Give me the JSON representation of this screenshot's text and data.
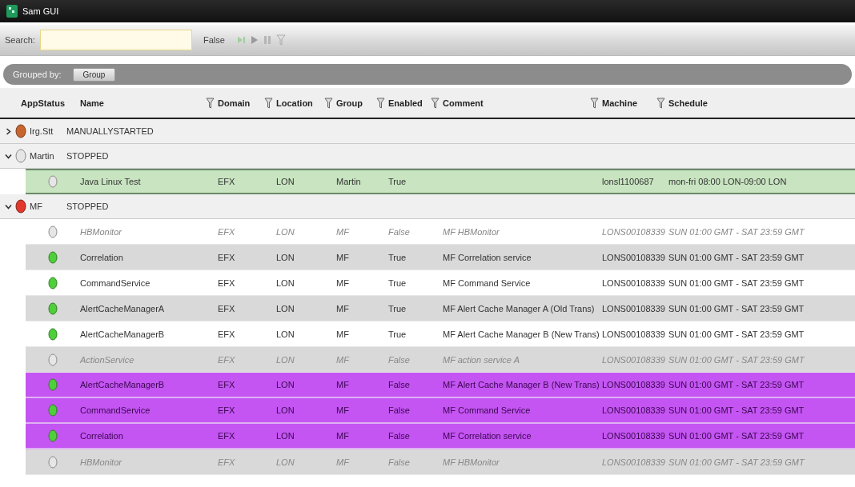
{
  "window": {
    "title": "Sam GUI"
  },
  "toolbar": {
    "search_label": "Search:",
    "toggle_label": "False"
  },
  "grouping": {
    "label": "Grouped by:",
    "chips": [
      "Group"
    ]
  },
  "table": {
    "columns": [
      {
        "label": "AppStatus",
        "filter": false
      },
      {
        "label": "Name",
        "filter": true
      },
      {
        "label": "Domain",
        "filter": true
      },
      {
        "label": "Location",
        "filter": true
      },
      {
        "label": "Group",
        "filter": true
      },
      {
        "label": "Enabled",
        "filter": true
      },
      {
        "label": "Comment",
        "filter": true
      },
      {
        "label": "Machine",
        "filter": true
      },
      {
        "label": "Schedule",
        "filter": false
      }
    ],
    "groups": [
      {
        "name": "Irg.Stt",
        "state": "MANUALLYSTARTED",
        "status": {
          "color": "#c8652e"
        },
        "expanded": false
      },
      {
        "name": "Martin",
        "state": "STOPPED",
        "status": {
          "color": "#e6e6e6"
        },
        "expanded": true,
        "children": [
          {
            "status": {
              "color": "#e6e6e6"
            },
            "disabled": false,
            "highlight": {
              "color": "#c8e4c0"
            },
            "cells": [
              "Java Linux Test",
              "EFX",
              "LON",
              "Martin",
              "True",
              "",
              "lonsl1100687",
              "mon-fri 08:00 LON-09:00 LON"
            ]
          }
        ]
      },
      {
        "name": "MF",
        "state": "STOPPED",
        "status": {
          "color": "#e0392b"
        },
        "expanded": true,
        "children": [
          {
            "status": {
              "color": "#e6e6e6"
            },
            "disabled": true,
            "cells": [
              "HBMonitor",
              "EFX",
              "LON",
              "MF",
              "False",
              "MF HBMonitor",
              "LONS00108339",
              "SUN 01:00 GMT - SAT 23:59 GMT"
            ]
          },
          {
            "status": {
              "color": "#4fcf3a"
            },
            "disabled": false,
            "cells": [
              "Correlation",
              "EFX",
              "LON",
              "MF",
              "True",
              "MF Correlation service",
              "LONS00108339",
              "SUN 01:00 GMT - SAT 23:59 GMT"
            ]
          },
          {
            "status": {
              "color": "#4fcf3a"
            },
            "disabled": false,
            "cells": [
              "CommandService",
              "EFX",
              "LON",
              "MF",
              "True",
              "MF Command Service",
              "LONS00108339",
              "SUN 01:00 GMT - SAT 23:59 GMT"
            ]
          },
          {
            "status": {
              "color": "#4fcf3a"
            },
            "disabled": false,
            "cells": [
              "AlertCacheManagerA",
              "EFX",
              "LON",
              "MF",
              "True",
              "MF Alert Cache Manager A (Old Trans)",
              "LONS00108339",
              "SUN 01:00 GMT - SAT 23:59 GMT"
            ]
          },
          {
            "status": {
              "color": "#4fcf3a"
            },
            "disabled": false,
            "cells": [
              "AlertCacheManagerB",
              "EFX",
              "LON",
              "MF",
              "True",
              "MF Alert Cache Manager B (New Trans)",
              "LONS00108339",
              "SUN 01:00 GMT - SAT 23:59 GMT"
            ]
          },
          {
            "status": {
              "color": "#e6e6e6"
            },
            "disabled": true,
            "cells": [
              "ActionService",
              "EFX",
              "LON",
              "MF",
              "False",
              "MF action service A",
              "LONS00108339",
              "SUN 01:00 GMT - SAT 23:59 GMT"
            ]
          },
          {
            "status": {
              "color": "#4fcf3a"
            },
            "disabled": false,
            "highlight": {
              "color": "#c455f2"
            },
            "cells": [
              "AlertCacheManagerB",
              "EFX",
              "LON",
              "MF",
              "False",
              "MF Alert Cache Manager B (New Trans)",
              "LONS00108339",
              "SUN 01:00 GMT - SAT 23:59 GMT"
            ]
          },
          {
            "status": {
              "color": "#4fcf3a"
            },
            "disabled": false,
            "highlight": {
              "color": "#c455f2"
            },
            "cells": [
              "CommandService",
              "EFX",
              "LON",
              "MF",
              "False",
              "MF Command Service",
              "LONS00108339",
              "SUN 01:00 GMT - SAT 23:59 GMT"
            ]
          },
          {
            "status": {
              "color": "#4fcf3a"
            },
            "disabled": false,
            "highlight": {
              "color": "#c455f2"
            },
            "cells": [
              "Correlation",
              "EFX",
              "LON",
              "MF",
              "False",
              "MF Correlation service",
              "LONS00108339",
              "SUN 01:00 GMT - SAT 23:59 GMT"
            ]
          },
          {
            "status": {
              "color": "#e6e6e6"
            },
            "disabled": true,
            "cells": [
              "HBMonitor",
              "EFX",
              "LON",
              "MF",
              "False",
              "MF HBMonitor",
              "LONS00108339",
              "SUN 01:00 GMT - SAT 23:59 GMT"
            ]
          }
        ]
      }
    ]
  }
}
